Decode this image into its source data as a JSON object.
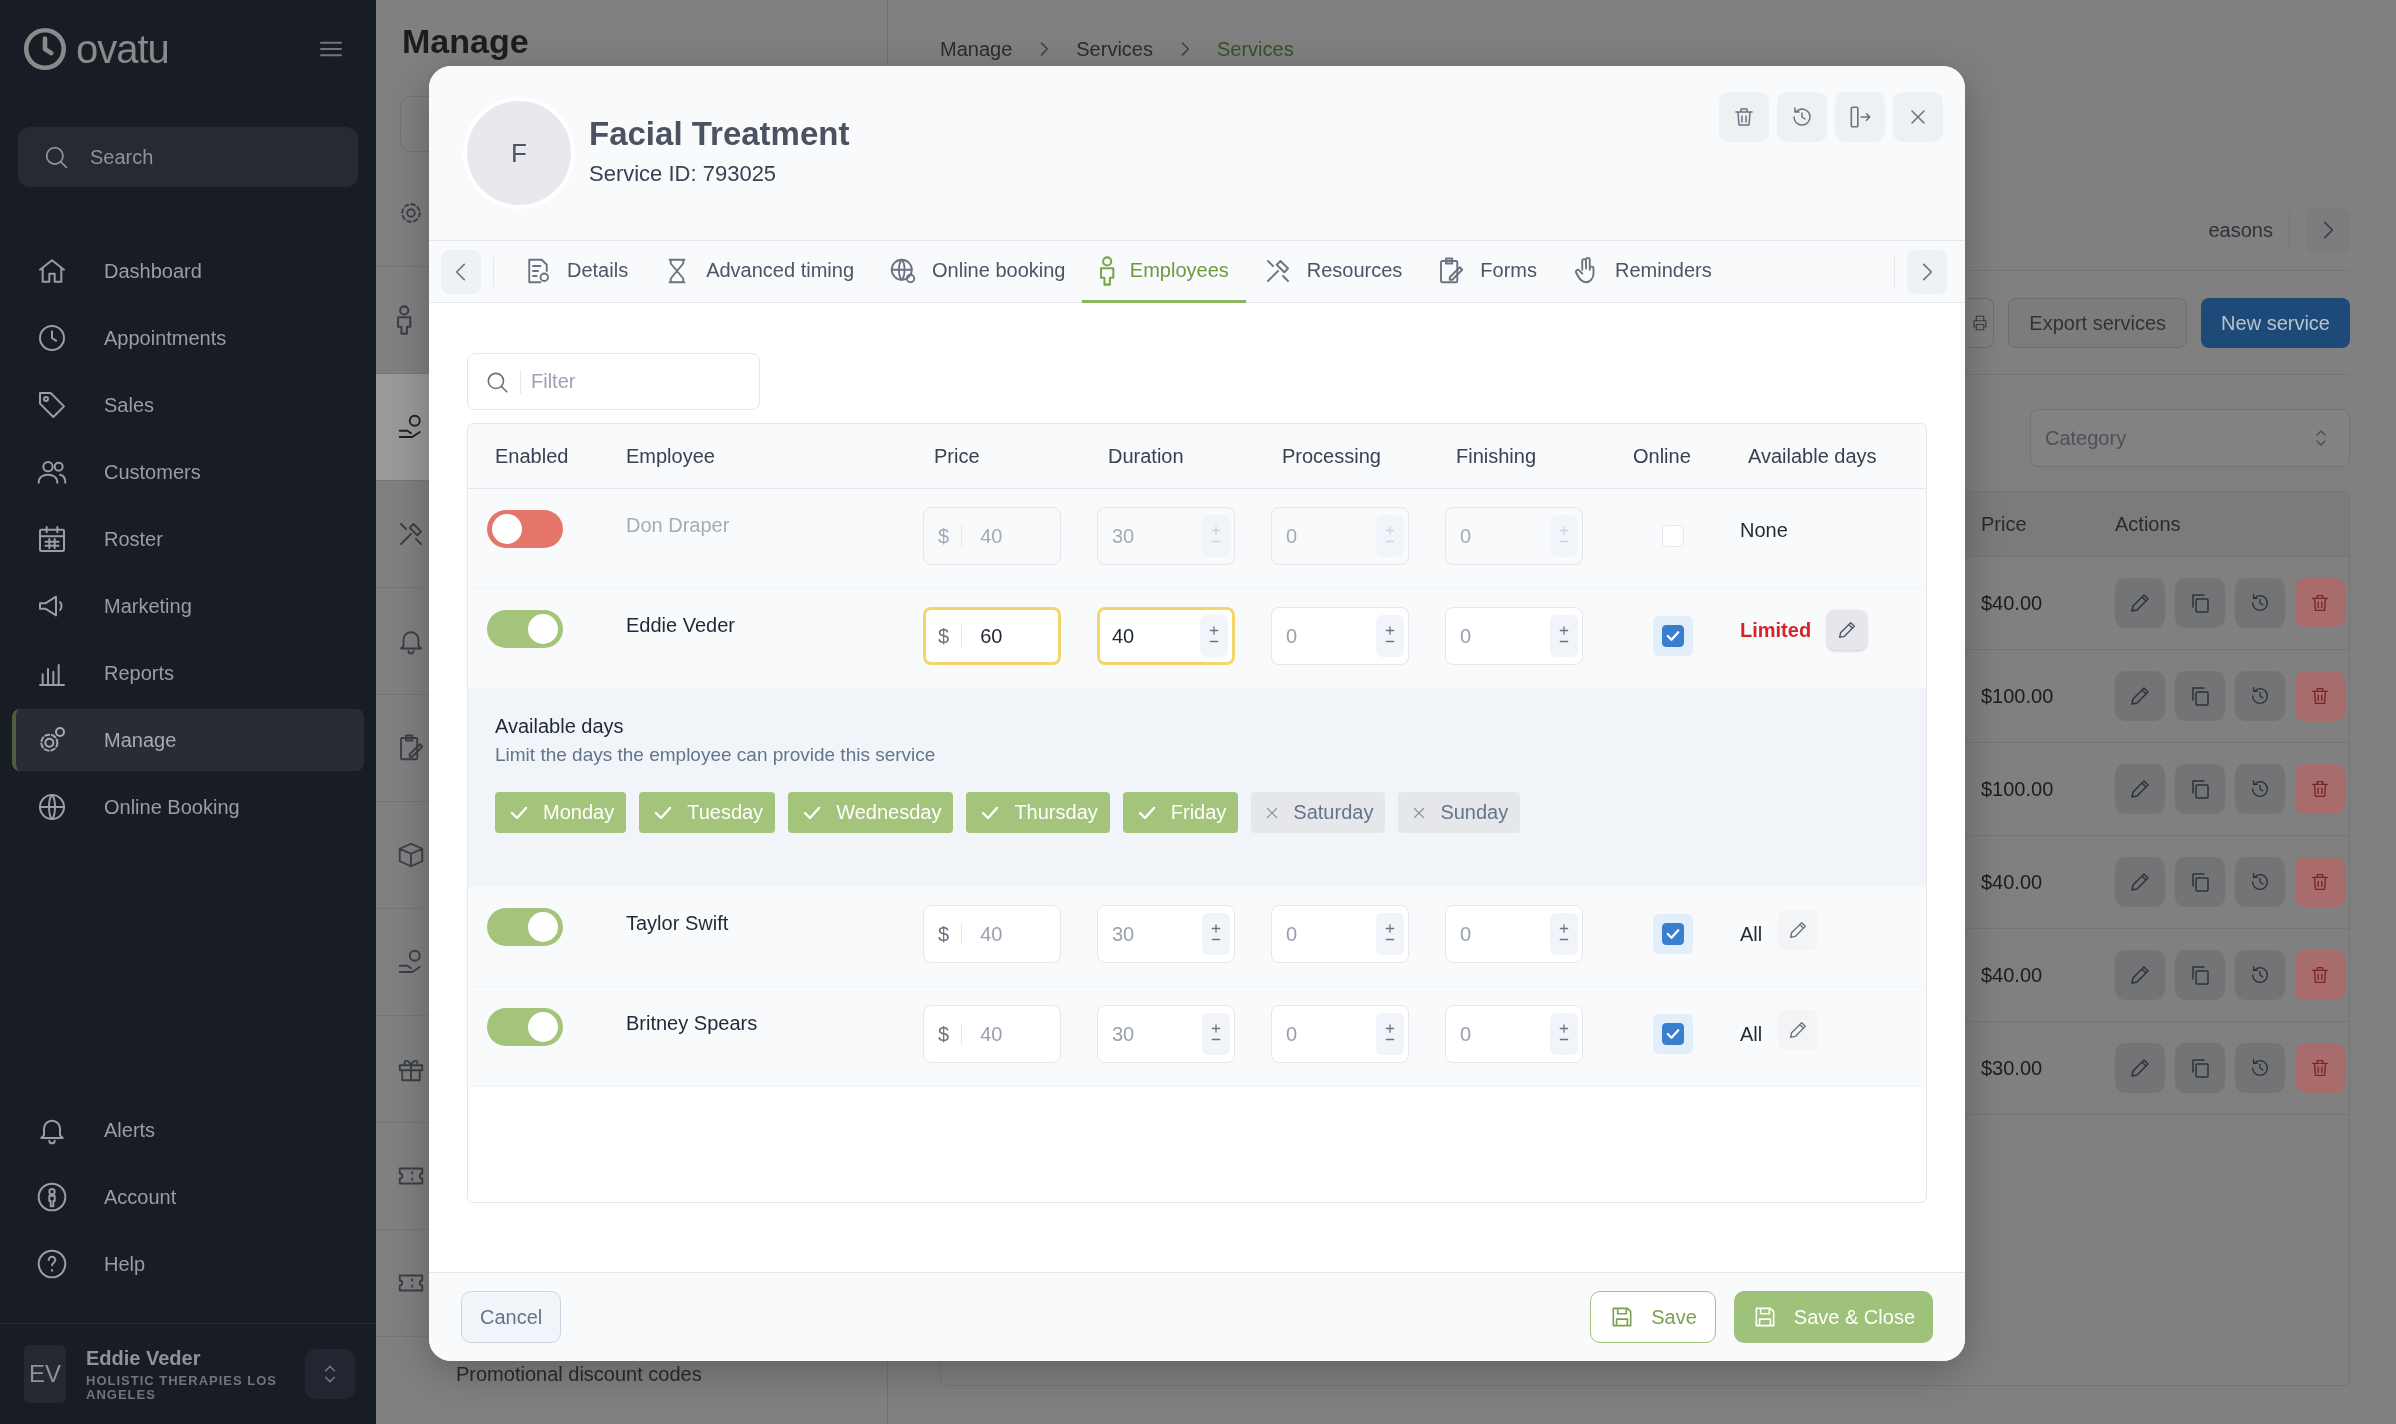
{
  "sidebar": {
    "logo": "ovatu",
    "search": {
      "placeholder": "Search"
    },
    "items": [
      {
        "label": "Dashboard",
        "selected": false
      },
      {
        "label": "Appointments",
        "selected": false
      },
      {
        "label": "Sales",
        "selected": false
      },
      {
        "label": "Customers",
        "selected": false
      },
      {
        "label": "Roster",
        "selected": false
      },
      {
        "label": "Marketing",
        "selected": false
      },
      {
        "label": "Reports",
        "selected": false
      },
      {
        "label": "Manage",
        "selected": true
      },
      {
        "label": "Online Booking",
        "selected": false
      }
    ],
    "bottom_items": [
      {
        "label": "Alerts",
        "selected": false
      },
      {
        "label": "Account",
        "selected": false
      },
      {
        "label": "Help",
        "selected": false
      }
    ],
    "user": {
      "initials": "EV",
      "name": "Eddie Veder",
      "business": "HOLISTIC THERAPIES LOS ANGELES"
    }
  },
  "page": {
    "title": "Manage",
    "breadcrumbs": [
      {
        "label": "Manage",
        "current": false
      },
      {
        "label": "Services",
        "current": false
      },
      {
        "label": "Services",
        "current": true
      }
    ],
    "settings_list": [
      {
        "selected": false
      },
      {
        "selected": false
      },
      {
        "selected": true
      },
      {
        "selected": false
      },
      {
        "selected": false
      },
      {
        "selected": false
      },
      {
        "selected": false
      },
      {
        "selected": false
      },
      {
        "selected": false
      },
      {
        "selected": false
      },
      {
        "selected": false
      }
    ],
    "settings_caption": "Promotional discount codes",
    "tab_partial": "easons",
    "buttons": [
      {
        "label": "Export services",
        "kind": "secondary"
      },
      {
        "label": "New service",
        "kind": "primary"
      }
    ],
    "category": {
      "placeholder": "Category"
    },
    "table": {
      "columns": [
        "Price",
        "Actions"
      ],
      "rows": [
        {
          "price": "$40.00"
        },
        {
          "price": "$100.00"
        },
        {
          "price": "$100.00"
        },
        {
          "price": "$40.00"
        },
        {
          "price": "$40.00"
        },
        {
          "price": "$30.00"
        }
      ]
    }
  },
  "modal": {
    "avatar": "F",
    "title": "Facial Treatment",
    "subtitle": "Service ID: 793025",
    "tabs": [
      {
        "label": "Details",
        "selected": false
      },
      {
        "label": "Advanced timing",
        "selected": false
      },
      {
        "label": "Online booking",
        "selected": false
      },
      {
        "label": "Employees",
        "selected": true
      },
      {
        "label": "Resources",
        "selected": false
      },
      {
        "label": "Forms",
        "selected": false
      },
      {
        "label": "Reminders",
        "selected": false
      }
    ],
    "filter": {
      "placeholder": "Filter"
    },
    "columns": [
      "Enabled",
      "Employee",
      "Price",
      "Duration",
      "Processing",
      "Finishing",
      "Online",
      "Available days"
    ],
    "employees": [
      {
        "name": "Don Draper",
        "enabled": false,
        "price": {
          "prefix": "$",
          "placeholder": "40",
          "modified": false
        },
        "duration": {
          "placeholder": "30",
          "modified": false
        },
        "processing": {
          "placeholder": "0",
          "modified": false
        },
        "finishing": {
          "placeholder": "0",
          "modified": false
        },
        "online": false,
        "days": {
          "text": "None",
          "kind": "none"
        }
      },
      {
        "name": "Eddie Veder",
        "enabled": true,
        "price": {
          "prefix": "$",
          "value": "60",
          "modified": true
        },
        "duration": {
          "value": "40",
          "modified": true
        },
        "processing": {
          "placeholder": "0",
          "modified": false
        },
        "finishing": {
          "placeholder": "0",
          "modified": false
        },
        "online": true,
        "days": {
          "text": "Limited",
          "kind": "limited"
        },
        "days_panel": {
          "title": "Available days",
          "description": "Limit the days the employee can provide this service",
          "days": [
            {
              "label": "Monday",
              "selected": true
            },
            {
              "label": "Tuesday",
              "selected": true
            },
            {
              "label": "Wednesday",
              "selected": true
            },
            {
              "label": "Thursday",
              "selected": true
            },
            {
              "label": "Friday",
              "selected": true
            },
            {
              "label": "Saturday",
              "selected": false
            },
            {
              "label": "Sunday",
              "selected": false
            }
          ]
        }
      },
      {
        "name": "Taylor Swift",
        "enabled": true,
        "price": {
          "prefix": "$",
          "placeholder": "40",
          "modified": false
        },
        "duration": {
          "placeholder": "30",
          "modified": false
        },
        "processing": {
          "placeholder": "0",
          "modified": false
        },
        "finishing": {
          "placeholder": "0",
          "modified": false
        },
        "online": true,
        "days": {
          "text": "All",
          "kind": "all"
        }
      },
      {
        "name": "Britney Spears",
        "enabled": true,
        "price": {
          "prefix": "$",
          "placeholder": "40",
          "modified": false
        },
        "duration": {
          "placeholder": "30",
          "modified": false
        },
        "processing": {
          "placeholder": "0",
          "modified": false
        },
        "finishing": {
          "placeholder": "0",
          "modified": false
        },
        "online": true,
        "days": {
          "text": "All",
          "kind": "all"
        }
      }
    ],
    "footer": {
      "cancel": "Cancel",
      "save": "Save",
      "save_close": "Save & Close"
    }
  }
}
